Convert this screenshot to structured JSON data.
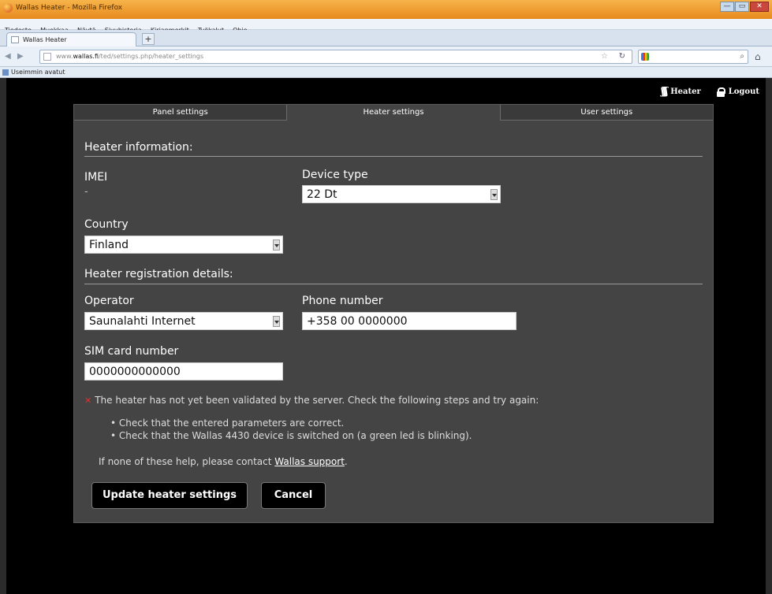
{
  "browser": {
    "window_title": "Wallas Heater - Mozilla Firefox",
    "menu": [
      "Tiedosto",
      "Muokkaa",
      "Näytä",
      "Sivuhistoria",
      "Kirjanmerkit",
      "Työkalut",
      "Ohje"
    ],
    "tab_title": "Wallas Heater",
    "url_prefix": "www.",
    "url_domain": "wallas.fi",
    "url_rest": "/ted/settings.php/heater_settings",
    "bookmark": "Useimmin avatut",
    "window_buttons": {
      "minimize": "—",
      "maximize": "▭",
      "close": "✕"
    }
  },
  "topnav": {
    "heater": "Heater",
    "logout": "Logout"
  },
  "tabs": [
    {
      "label": "Panel settings",
      "active": false
    },
    {
      "label": "Heater settings",
      "active": true
    },
    {
      "label": "User settings",
      "active": false
    }
  ],
  "heater_info": {
    "heading": "Heater information:",
    "imei_label": "IMEI",
    "imei_value": "-",
    "device_type_label": "Device type",
    "device_type_value": "22 Dt",
    "country_label": "Country",
    "country_value": "Finland"
  },
  "registration": {
    "heading": "Heater registration details:",
    "operator_label": "Operator",
    "operator_value": "Saunalahti Internet",
    "phone_label": "Phone number",
    "phone_value": "+358 00 0000000",
    "sim_label": "SIM card number",
    "sim_value": "0000000000000"
  },
  "message": {
    "error": "The heater has not yet been validated by the server. Check the following steps and try again:",
    "steps": [
      "Check that the entered parameters are correct.",
      "Check that the Wallas 4430 device is switched on (a green led is blinking)."
    ],
    "help_prefix": "If none of these help, please contact ",
    "help_link": "Wallas support",
    "help_suffix": "."
  },
  "buttons": {
    "update": "Update heater settings",
    "cancel": "Cancel"
  }
}
